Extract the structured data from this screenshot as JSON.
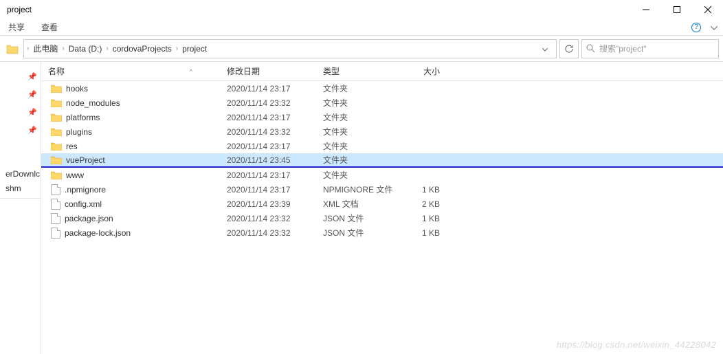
{
  "window": {
    "title": "project"
  },
  "menu": {
    "share": "共享",
    "view": "查看"
  },
  "breadcrumb": {
    "items": [
      "此电脑",
      "Data (D:)",
      "cordovaProjects",
      "project"
    ]
  },
  "search": {
    "placeholder": "搜索\"project\""
  },
  "sidebar": {
    "item1": "erDownlc",
    "item2": "shm"
  },
  "columns": {
    "name": "名称",
    "date": "修改日期",
    "type": "类型",
    "size": "大小"
  },
  "rows": [
    {
      "icon": "folder",
      "name": "hooks",
      "date": "2020/11/14 23:17",
      "type": "文件夹",
      "size": "",
      "selected": false
    },
    {
      "icon": "folder",
      "name": "node_modules",
      "date": "2020/11/14 23:32",
      "type": "文件夹",
      "size": "",
      "selected": false
    },
    {
      "icon": "folder",
      "name": "platforms",
      "date": "2020/11/14 23:17",
      "type": "文件夹",
      "size": "",
      "selected": false
    },
    {
      "icon": "folder",
      "name": "plugins",
      "date": "2020/11/14 23:32",
      "type": "文件夹",
      "size": "",
      "selected": false
    },
    {
      "icon": "folder",
      "name": "res",
      "date": "2020/11/14 23:17",
      "type": "文件夹",
      "size": "",
      "selected": false
    },
    {
      "icon": "folder",
      "name": "vueProject",
      "date": "2020/11/14 23:45",
      "type": "文件夹",
      "size": "",
      "selected": true
    },
    {
      "icon": "folder",
      "name": "www",
      "date": "2020/11/14 23:17",
      "type": "文件夹",
      "size": "",
      "selected": false
    },
    {
      "icon": "file",
      "name": ".npmignore",
      "date": "2020/11/14 23:17",
      "type": "NPMIGNORE 文件",
      "size": "1 KB",
      "selected": false
    },
    {
      "icon": "file",
      "name": "config.xml",
      "date": "2020/11/14 23:39",
      "type": "XML 文档",
      "size": "2 KB",
      "selected": false
    },
    {
      "icon": "file",
      "name": "package.json",
      "date": "2020/11/14 23:32",
      "type": "JSON 文件",
      "size": "1 KB",
      "selected": false
    },
    {
      "icon": "file",
      "name": "package-lock.json",
      "date": "2020/11/14 23:32",
      "type": "JSON 文件",
      "size": "1 KB",
      "selected": false
    }
  ],
  "watermark": "https://blog.csdn.net/weixin_44228042"
}
